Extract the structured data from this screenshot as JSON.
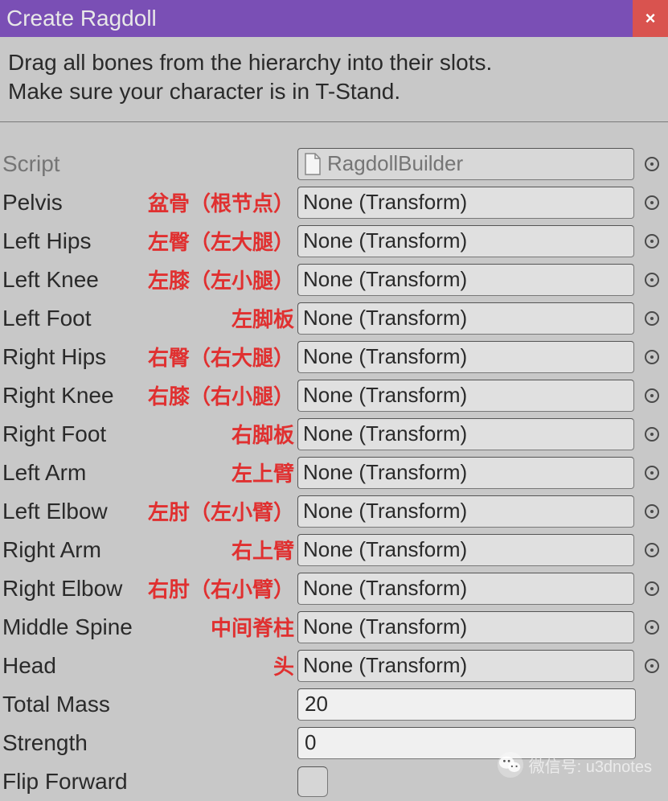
{
  "titlebar": {
    "title": "Create Ragdoll",
    "close": "×"
  },
  "instruction": "Drag all bones from the hierarchy into their slots.\nMake sure your character is in T-Stand.",
  "scriptRow": {
    "label": "Script",
    "value": "RagdollBuilder"
  },
  "boneRows": [
    {
      "label": "Pelvis",
      "annotation": "盆骨（根节点）",
      "value": "None (Transform)"
    },
    {
      "label": "Left Hips",
      "annotation": "左臀（左大腿）",
      "value": "None (Transform)"
    },
    {
      "label": "Left Knee",
      "annotation": "左膝（左小腿）",
      "value": "None (Transform)"
    },
    {
      "label": "Left Foot",
      "annotation": "左脚板",
      "value": "None (Transform)"
    },
    {
      "label": "Right Hips",
      "annotation": "右臀（右大腿）",
      "value": "None (Transform)"
    },
    {
      "label": "Right Knee",
      "annotation": "右膝（右小腿）",
      "value": "None (Transform)"
    },
    {
      "label": "Right Foot",
      "annotation": "右脚板",
      "value": "None (Transform)"
    },
    {
      "label": "Left Arm",
      "annotation": "左上臂",
      "value": "None (Transform)"
    },
    {
      "label": "Left Elbow",
      "annotation": "左肘（左小臂）",
      "value": "None (Transform)"
    },
    {
      "label": "Right Arm",
      "annotation": "右上臂",
      "value": "None (Transform)"
    },
    {
      "label": "Right Elbow",
      "annotation": "右肘（右小臂）",
      "value": "None (Transform)"
    },
    {
      "label": "Middle Spine",
      "annotation": "中间脊柱",
      "value": "None (Transform)"
    },
    {
      "label": "Head",
      "annotation": "头",
      "value": "None (Transform)"
    }
  ],
  "numberRows": [
    {
      "label": "Total Mass",
      "value": "20"
    },
    {
      "label": "Strength",
      "value": "0"
    }
  ],
  "flipForward": {
    "label": "Flip Forward"
  },
  "watermark": "微信号: u3dnotes"
}
